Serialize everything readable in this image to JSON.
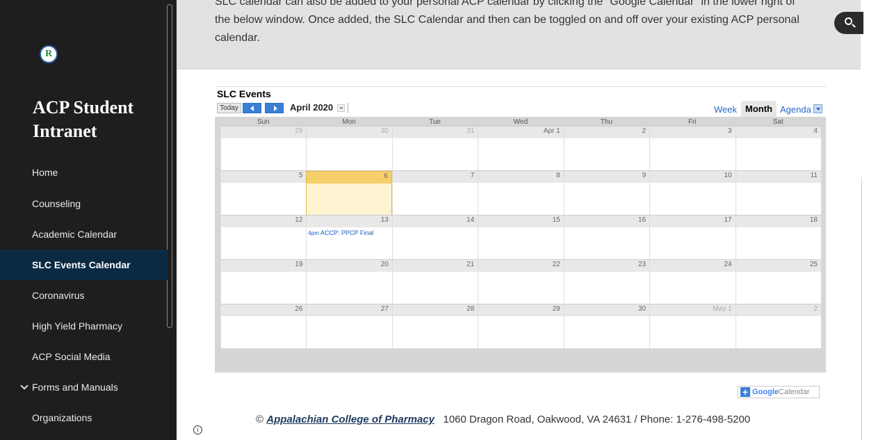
{
  "sidebar": {
    "logo_text": "R",
    "site_title": "ACP Student Intranet",
    "items": [
      {
        "label": "Home"
      },
      {
        "label": "Counseling"
      },
      {
        "label": "Academic Calendar"
      },
      {
        "label": "SLC Events Calendar",
        "active": true
      },
      {
        "label": "Coronavirus"
      },
      {
        "label": "High Yield Pharmacy"
      },
      {
        "label": "ACP Social Media"
      },
      {
        "label": "Forms and Manuals",
        "expandable": true
      },
      {
        "label": "Organizations"
      }
    ]
  },
  "banner": {
    "line_top": "SLC calendar can also be added to your personal ACP calendar by clicking the \"Google Calendar\" in the lower right of",
    "line_main": "the below window.  Once added, the SLC Calendar and then can be toggled on and off over your existing ACP personal calendar."
  },
  "search": {
    "icon": "search-icon"
  },
  "calendar": {
    "title": "SLC Events",
    "today_label": "Today",
    "month_label": "April 2020",
    "views": {
      "week": "Week",
      "month": "Month",
      "agenda": "Agenda"
    },
    "weekdays": [
      "Sun",
      "Mon",
      "Tue",
      "Wed",
      "Thu",
      "Fri",
      "Sat"
    ],
    "weeks": [
      [
        "29",
        "30",
        "31",
        "Apr 1",
        "2",
        "3",
        "4"
      ],
      [
        "5",
        "6",
        "7",
        "8",
        "9",
        "10",
        "11"
      ],
      [
        "12",
        "13",
        "14",
        "15",
        "16",
        "17",
        "18"
      ],
      [
        "19",
        "20",
        "21",
        "22",
        "23",
        "24",
        "25"
      ],
      [
        "26",
        "27",
        "28",
        "29",
        "30",
        "May 1",
        "2"
      ]
    ],
    "event": {
      "time": "4pm",
      "title": "ACCP: PPCP Final"
    },
    "google_label": "Google",
    "calendar_label": "Calendar"
  },
  "footer": {
    "copyright": "©",
    "college": "Appalachian College of Pharmacy",
    "address": "1060 Dragon Road, Oakwood, VA 24631  /  Phone:  1-276-498-5200"
  }
}
